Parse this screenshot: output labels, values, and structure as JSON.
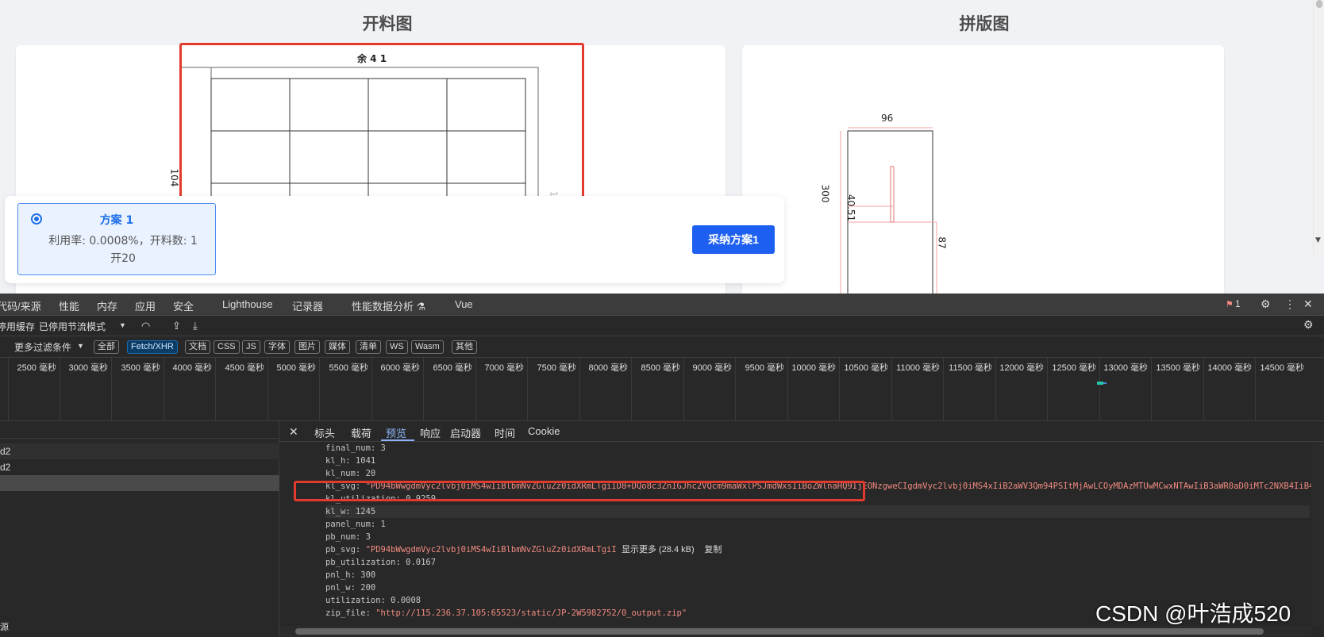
{
  "page": {
    "left_title": "开料图",
    "right_title": "拼版图",
    "cut_label_top": "余 4 1",
    "cut_label_left": "104",
    "cut_label_right": "14.5",
    "panel_width_label": "96",
    "panel_height_label": "300",
    "panel_inner_label": "40.51",
    "panel_side_label": "87"
  },
  "plan": {
    "name": "方案 1",
    "info": "利用率: 0.0008%，开料数: 1开20",
    "adopt_button": "采纳方案1"
  },
  "devtools": {
    "tabs": [
      "代码/来源",
      "性能",
      "内存",
      "应用",
      "安全",
      "Lighthouse",
      "记录器",
      "性能数据分析 ⚗",
      "Vue"
    ],
    "issues_count": "1",
    "toolbar": {
      "cache": "停用缓存",
      "throttle": "已停用节流模式"
    },
    "filter": {
      "more": "更多过滤条件",
      "chips": [
        "全部",
        "Fetch/XHR",
        "文档",
        "CSS",
        "JS",
        "字体",
        "图片",
        "媒体",
        "清单",
        "WS",
        "Wasm",
        "其他"
      ]
    },
    "timeline_ticks": [
      "2500 毫秒",
      "3000 毫秒",
      "3500 毫秒",
      "4000 毫秒",
      "4500 毫秒",
      "5000 毫秒",
      "5500 毫秒",
      "6000 毫秒",
      "6500 毫秒",
      "7000 毫秒",
      "7500 毫秒",
      "8000 毫秒",
      "8500 毫秒",
      "9000 毫秒",
      "9500 毫秒",
      "10000 毫秒",
      "10500 毫秒",
      "11000 毫秒",
      "11500 毫秒",
      "12000 毫秒",
      "12500 毫秒",
      "13000 毫秒",
      "13500 毫秒",
      "14000 毫秒",
      "14500 毫秒"
    ],
    "requests": [
      "d2",
      "d2",
      ""
    ],
    "detail_tabs": [
      "标头",
      "载荷",
      "预览",
      "响应",
      "启动器",
      "时间",
      "Cookie"
    ],
    "preview": {
      "final_num": "final_num: 3",
      "kl_h": "kl_h: 1041",
      "kl_num": "kl_num: 20",
      "kl_svg_key": "kl_svg: ",
      "kl_svg_val": "\"PD94bWwgdmVyc2lvbj0iMS4wIiBlbmNvZGluZz0idXRmLTgiID8+DQo8c3ZnIGJhc2VQcm9maWxlPSJmdWxsIiBoZWlnaHQ9IjEONzgweCIgdmVyc2lvbj0iMS4xIiB2aWV3Qm94PSItMjAwLCOyMDAzMTUwMCwxNTAwIiB3aWR0aD0iMTc2NXB4IiB4bWxucz0iaH",
      "kl_utilization": "kl_utilization: 0.9259",
      "kl_w": "kl_w: 1245",
      "panel_num": "panel_num: 1",
      "pb_num": "pb_num: 3",
      "pb_svg_key": "pb_svg: ",
      "pb_svg_val": "\"PD94bWwgdmVyc2lvbj0iMS4wIiBlbmNvZGluZz0idXRmLTgiI",
      "pb_show_more": "显示更多 (28.4 kB)",
      "pb_copy": "复制",
      "pb_utilization": "pb_utilization: 0.0167",
      "pnl_h": "pnl_h: 300",
      "pnl_w": "pnl_w: 200",
      "utilization": "utilization: 0.0008",
      "zip_file_key": "zip_file: ",
      "zip_file_val": "\"http://115.236.37.105:65523/static/JP-2W5982752/0_output.zip\""
    },
    "footer_label": "源"
  },
  "watermark": "CSDN @叶浩成520",
  "colors": {
    "accent": "#1d5ff0",
    "highlight_red": "#e23b2e",
    "devtools_bg": "#282828"
  }
}
